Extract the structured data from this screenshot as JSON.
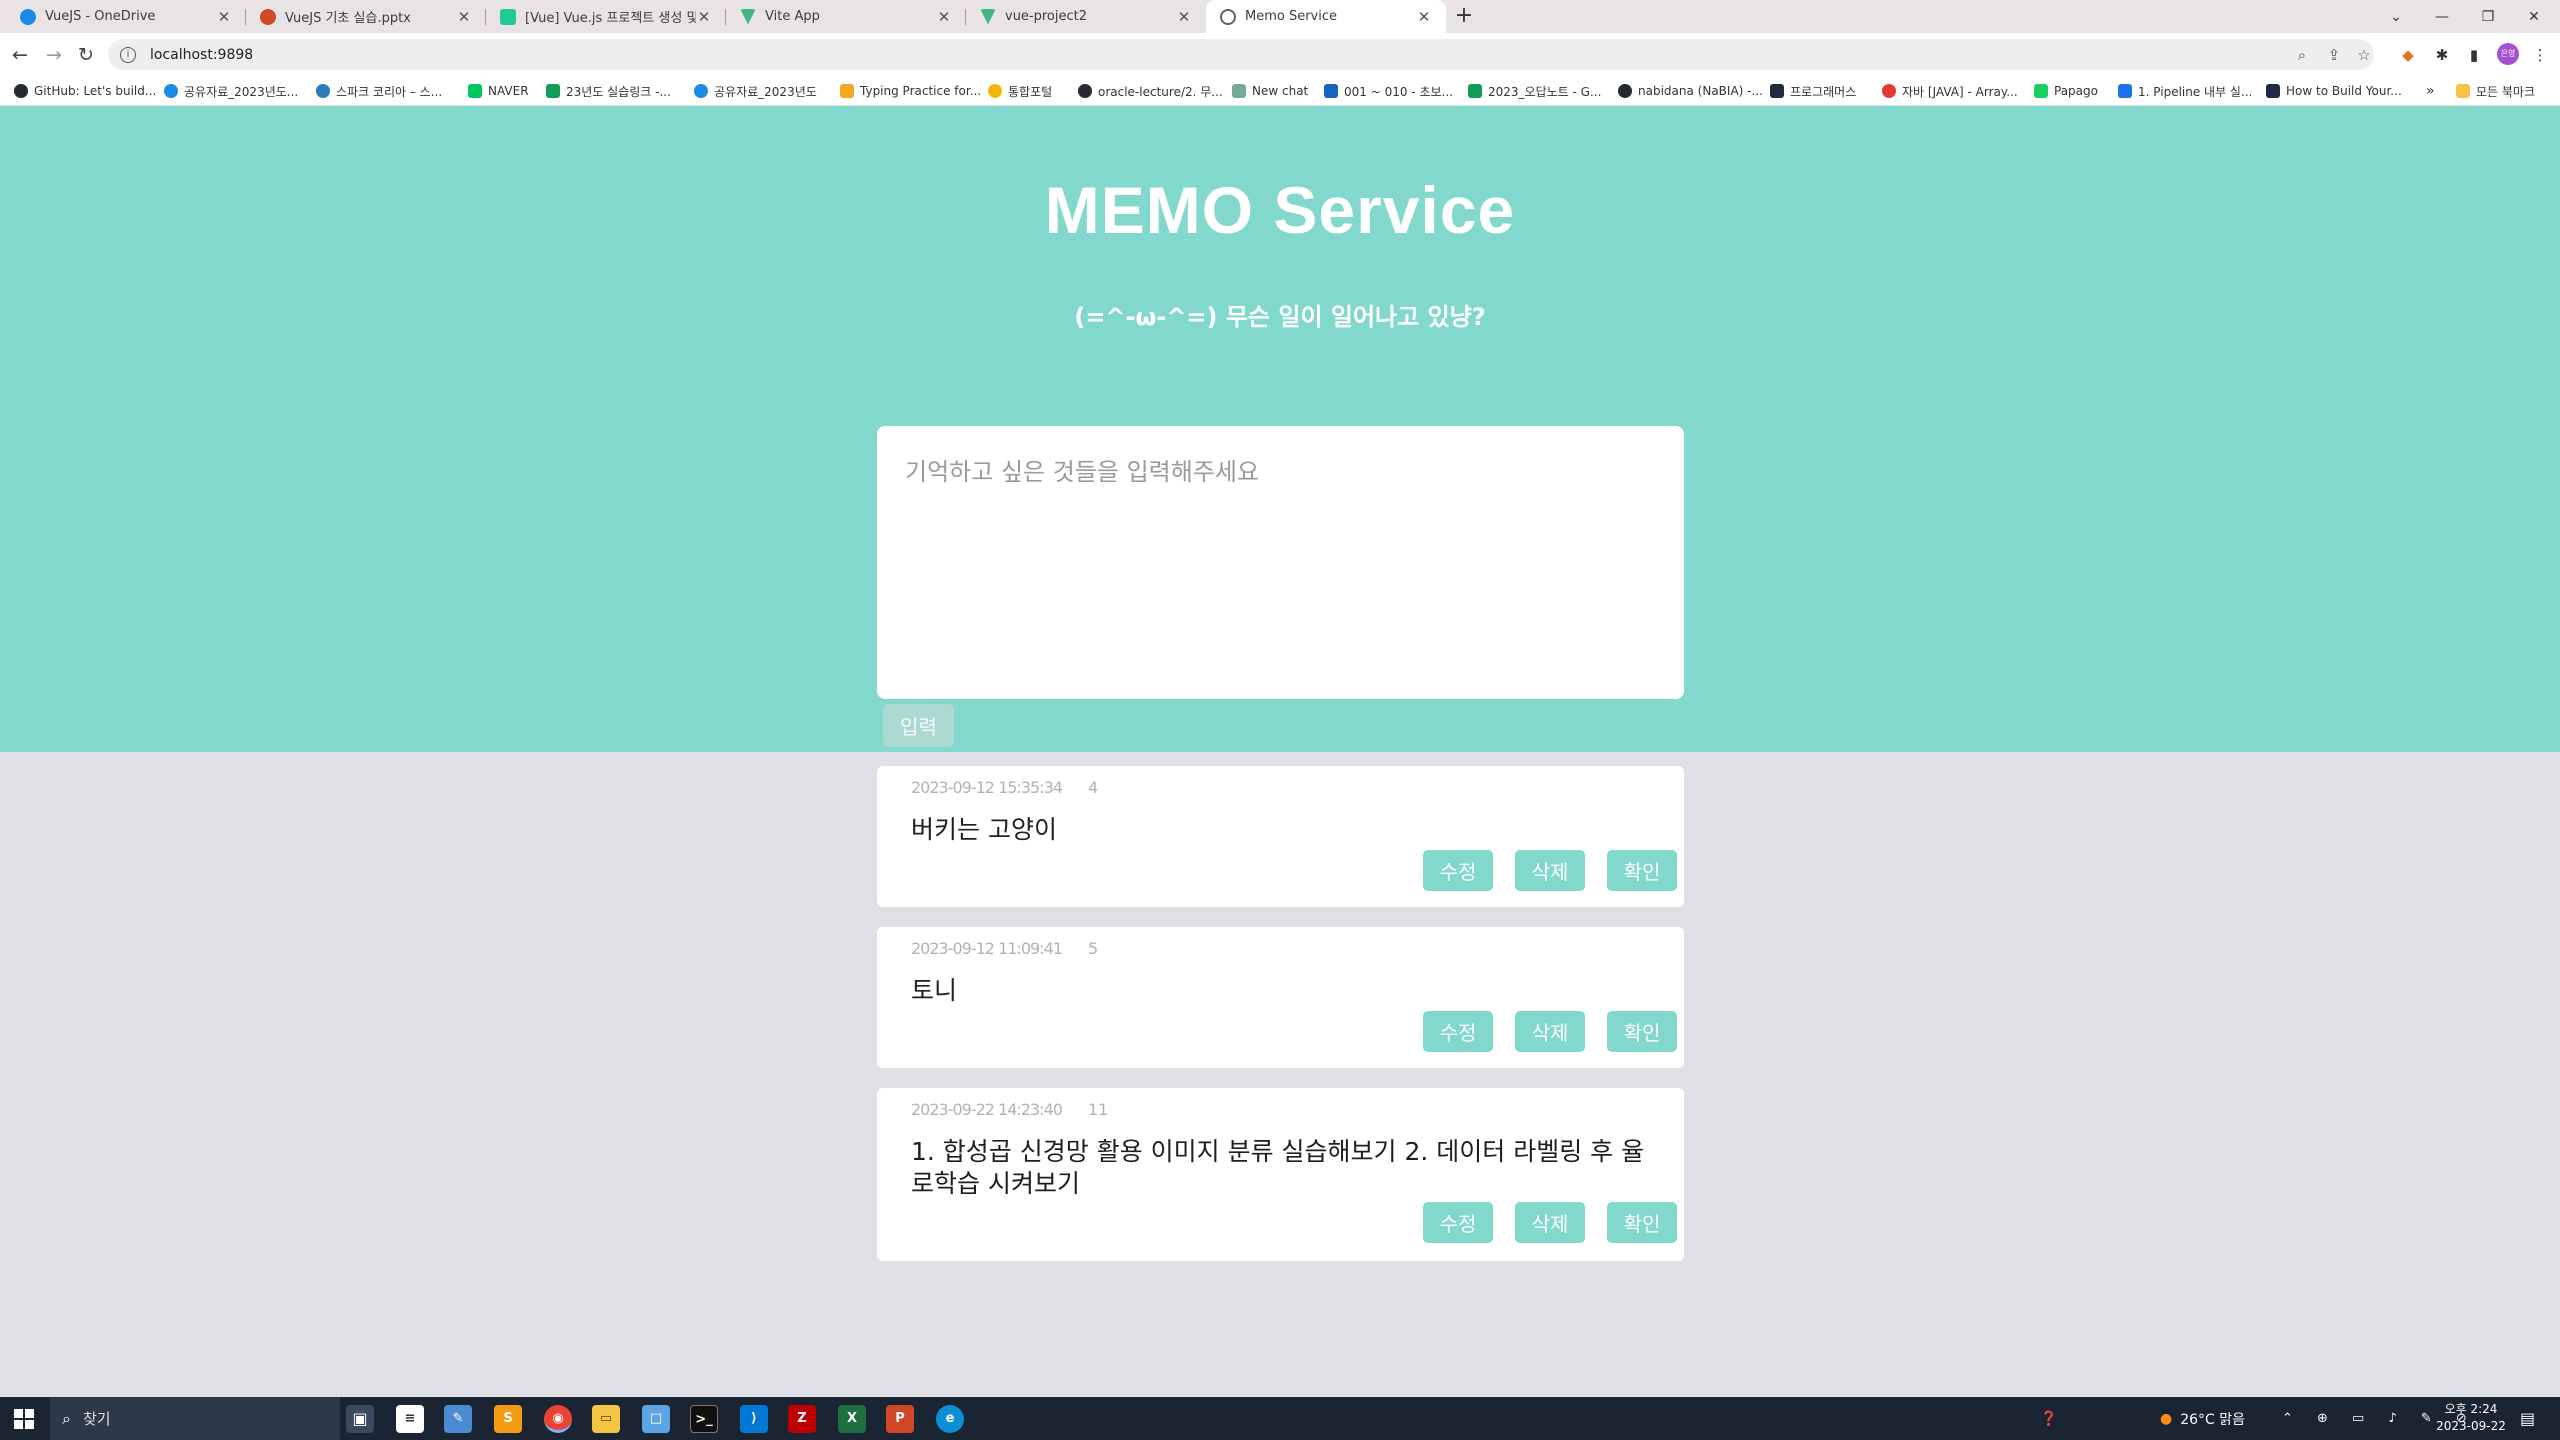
{
  "browser": {
    "tabs": [
      {
        "title": "VueJS - OneDrive",
        "favicon_color": "#1e88e5",
        "active": false
      },
      {
        "title": "VueJS 기초 실습.pptx",
        "favicon_color": "#d24726",
        "active": false
      },
      {
        "title": "[Vue] Vue.js 프로젝트 생성 및 기",
        "favicon_color": "#20c997",
        "active": false
      },
      {
        "title": "Vite App",
        "favicon_color": "#41b883",
        "active": false
      },
      {
        "title": "vue-project2",
        "favicon_color": "#41b883",
        "active": false
      },
      {
        "title": "Memo Service",
        "favicon_color": "#5f6368",
        "active": true
      }
    ],
    "url": "localhost:9898",
    "profile_initials": "은영",
    "bookmarks": [
      {
        "label": "GitHub: Let's build...",
        "color": "#24292f"
      },
      {
        "label": "공유자료_2023년도...",
        "color": "#1e88e5"
      },
      {
        "label": "스파크 코리아 – 스...",
        "color": "#2b7bb9"
      },
      {
        "label": "NAVER",
        "color": "#03c75a"
      },
      {
        "label": "23년도 실습링크 -...",
        "color": "#0f9d58"
      },
      {
        "label": "공유자료_2023년도",
        "color": "#1e88e5"
      },
      {
        "label": "Typing Practice for...",
        "color": "#f5a623"
      },
      {
        "label": "통합포털",
        "color": "#f2b705"
      },
      {
        "label": "oracle-lecture/2. 무...",
        "color": "#24292f"
      },
      {
        "label": "New chat",
        "color": "#74aa9c"
      },
      {
        "label": "001 ~ 010 - 초보...",
        "color": "#1565c0"
      },
      {
        "label": "2023_오답노트 - G...",
        "color": "#0f9d58"
      },
      {
        "label": "nabidana (NaBIA) -...",
        "color": "#24292f"
      },
      {
        "label": "프로그래머스",
        "color": "#202b3d"
      },
      {
        "label": "자바 [JAVA] - Array...",
        "color": "#e53935"
      },
      {
        "label": "Papago",
        "color": "#19ce60"
      },
      {
        "label": "1. Pipeline 내부 실...",
        "color": "#1a73e8"
      },
      {
        "label": "How to Build Your...",
        "color": "#1f2a44"
      }
    ],
    "all_bookmarks": "모든 북마크"
  },
  "app": {
    "title": "MEMO Service",
    "subtitle": "(=^-ω-^=) 무슨 일이 일어나고 있냥?",
    "input_placeholder": "기억하고 싶은 것들을 입력해주세요",
    "submit_label": "입력",
    "edit_label": "수정",
    "delete_label": "삭제",
    "confirm_label": "확인",
    "accent_color": "#82d8cd",
    "memos": [
      {
        "date": "2023-09-12 15:35:34",
        "id": "4",
        "content": "버키는 고양이"
      },
      {
        "date": "2023-09-12 11:09:41",
        "id": "5",
        "content": "토니"
      },
      {
        "date": "2023-09-22 14:23:40",
        "id": "11",
        "content": "1. 합성곱 신경망 활용 이미지 분류 실습해보기 2. 데이터 라벨링 후 율로학습 시켜보기"
      }
    ]
  },
  "taskbar": {
    "search_label": "찾기",
    "weather": "26°C 맑음",
    "time": "오후 2:24",
    "date": "2023-09-22"
  }
}
